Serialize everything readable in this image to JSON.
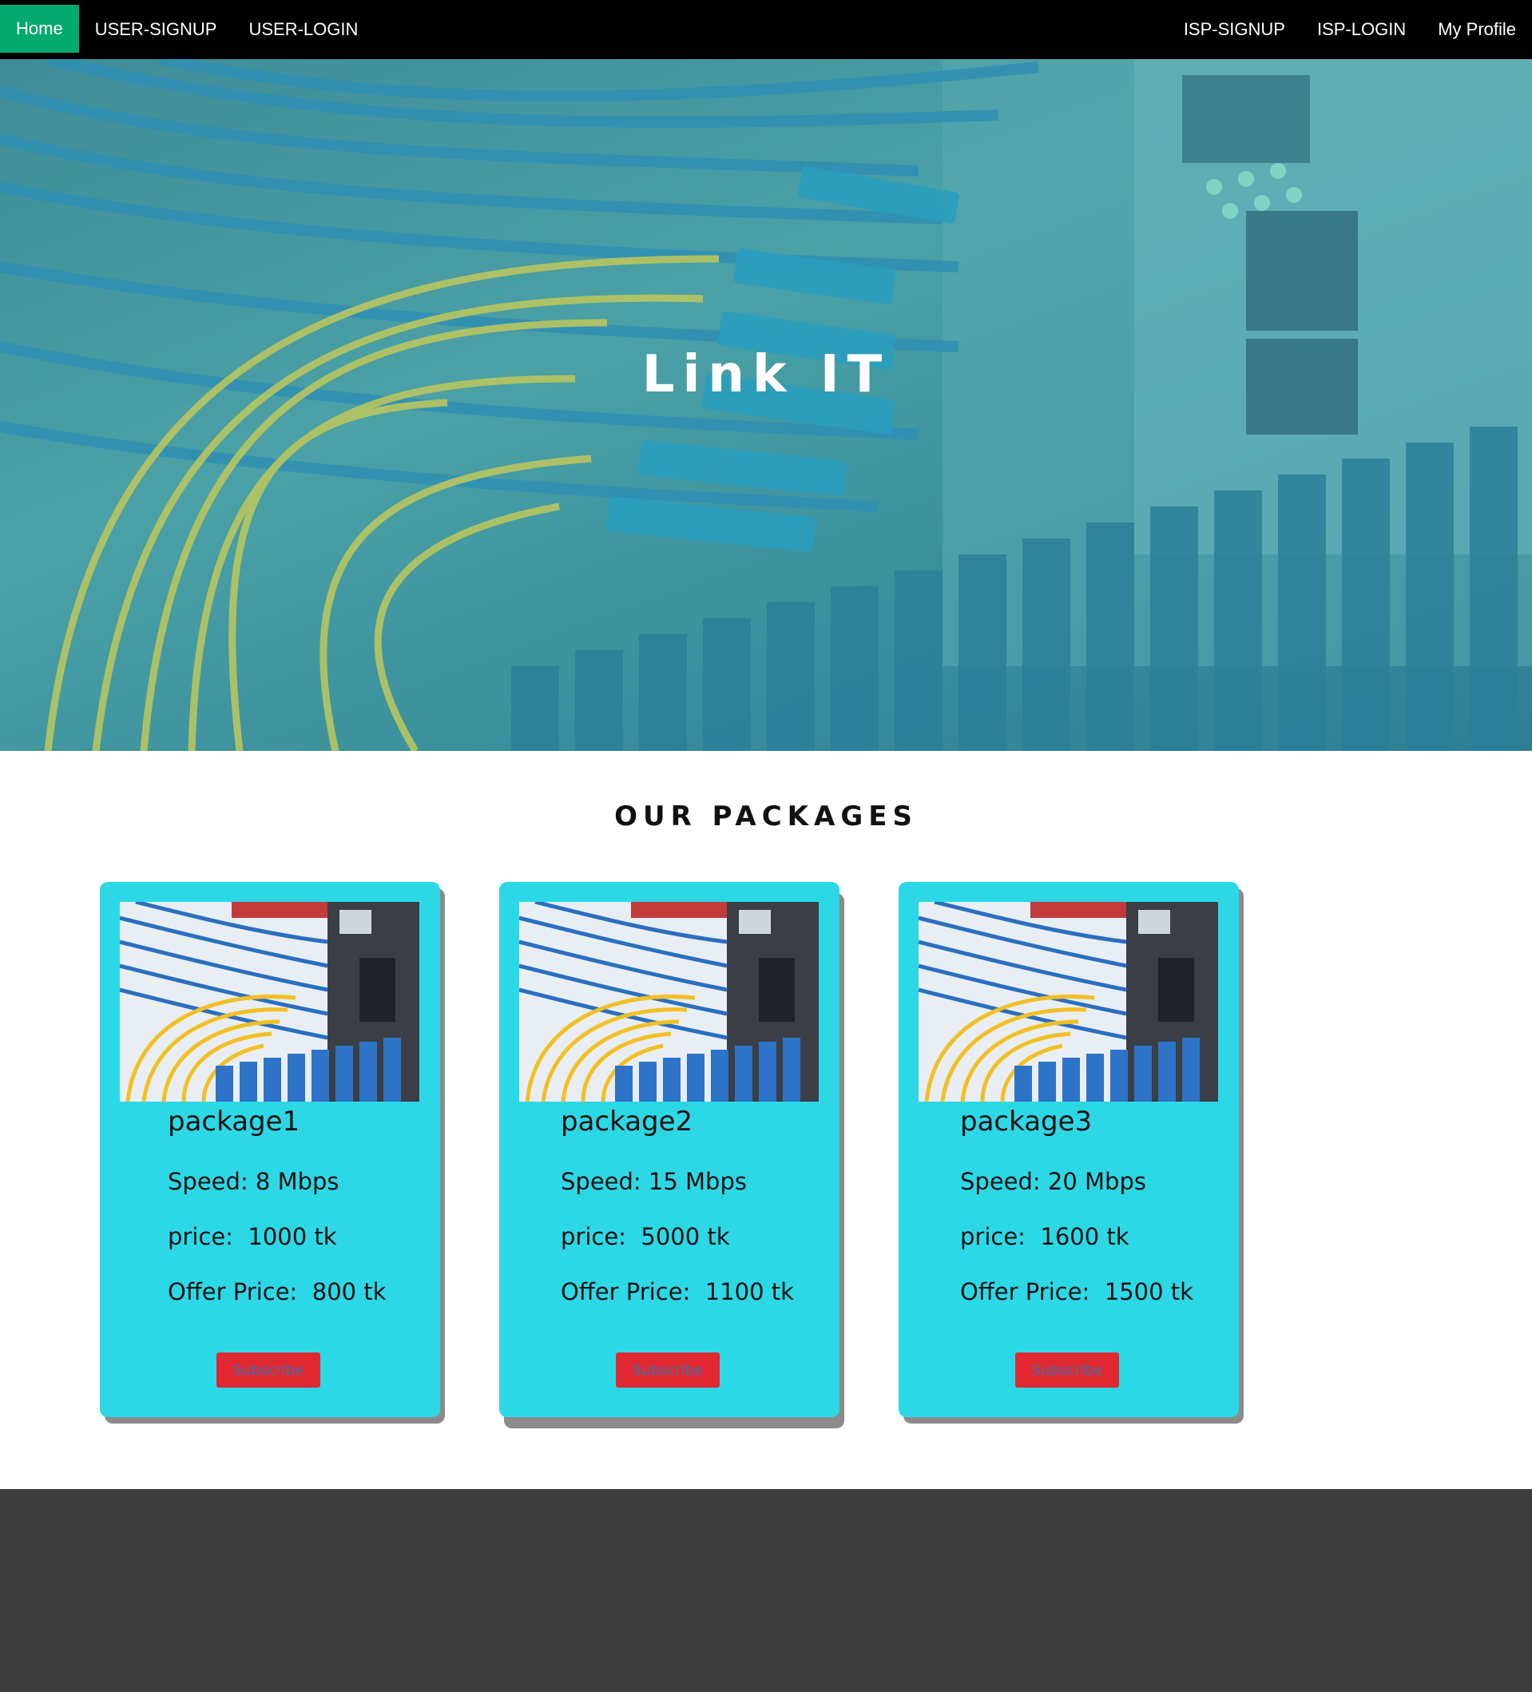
{
  "nav": {
    "left": [
      {
        "label": "Home",
        "active": true
      },
      {
        "label": "USER-SIGNUP"
      },
      {
        "label": "USER-LOGIN"
      }
    ],
    "right": [
      {
        "label": "ISP-SIGNUP"
      },
      {
        "label": "ISP-LOGIN"
      },
      {
        "label": "My Profile"
      }
    ],
    "active_color": "#04aa6d"
  },
  "hero": {
    "title": "Link  IT"
  },
  "packages": {
    "title": "OUR PACKAGES",
    "items": [
      {
        "name": "package1",
        "speed": "Speed: 8 Mbps",
        "price": "price:  1000 tk",
        "offer": "Offer Price:  800 tk",
        "button": "Subscribe"
      },
      {
        "name": "package2",
        "speed": "Speed: 15 Mbps",
        "price": "price:  5000 tk",
        "offer": "Offer Price:  1100 tk",
        "button": "Subscribe"
      },
      {
        "name": "package3",
        "speed": "Speed: 20 Mbps",
        "price": "price:  1600 tk",
        "offer": "Offer Price:  1500 tk",
        "button": "Subscribe"
      }
    ],
    "card_color": "#2dd8e6",
    "button_color": "#e12830"
  },
  "footer": {
    "color": "#3d3d3d"
  }
}
